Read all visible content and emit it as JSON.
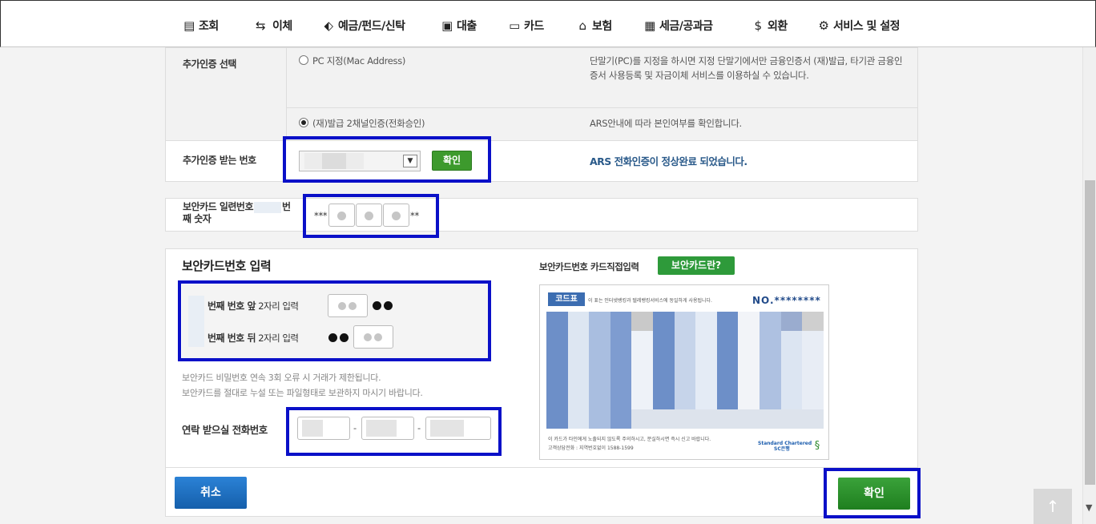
{
  "nav": [
    {
      "label": "조회",
      "icon": "list-icon",
      "glyph": "▤"
    },
    {
      "label": "이체",
      "icon": "transfer-icon",
      "glyph": "⇆"
    },
    {
      "label": "예금/펀드/신탁",
      "icon": "deposit-icon",
      "glyph": "⬖"
    },
    {
      "label": "대출",
      "icon": "loan-icon",
      "glyph": "▣"
    },
    {
      "label": "카드",
      "icon": "card-icon",
      "glyph": "▭"
    },
    {
      "label": "보험",
      "icon": "house-icon",
      "glyph": "⌂"
    },
    {
      "label": "세금/공과금",
      "icon": "tax-icon",
      "glyph": "▦"
    },
    {
      "label": "외환",
      "icon": "dollar-icon",
      "glyph": "$"
    },
    {
      "label": "서비스 및 설정",
      "icon": "gear-icon",
      "glyph": "⚙"
    }
  ],
  "auth": {
    "select_label": "추가인증 선택",
    "option_pc": "PC 지정(Mac Address)",
    "option_pc_desc": "단말기(PC)를 지정을 하시면 지정 단말기에서만 금융인증서 (재)발급, 타기관 금융인증서 사용등록 및 자금이체 서비스를 이용하실 수 있습니다.",
    "option_phone": "(재)발급 2채널인증(전화승인)",
    "option_phone_desc": "ARS안내에 따라 본인여부를 확인합니다.",
    "number_label": "추가인증 받는 번호",
    "confirm_small": "확인",
    "ars_message": "ARS 전화인증이 정상완료 되었습니다."
  },
  "serial": {
    "label_line1": "보안카드 일련번호",
    "label_line1_end": "번",
    "label_line2": "째 숫자",
    "prefix": "***",
    "suffix": "**"
  },
  "card_input": {
    "title": "보안카드번호 입력",
    "row1_label_bold": "번째 번호 앞",
    "row1_label_rest": " 2자리 입력",
    "row2_label_bold": "번째 번호 뒤",
    "row2_label_rest": " 2자리 입력",
    "warning1": "보안카드 비밀번호 연속 3회 오류 시 거래가 제한됩니다.",
    "warning2": "보안카드를 절대로 누설 또는 파일형태로 보관하지 마시기 바랍니다.",
    "phone_label": "연락 받으실 전화번호",
    "dash": "-"
  },
  "card_side": {
    "direct_input": "보안카드번호 카드직접입력",
    "what_button": "보안카드란?",
    "card_tag": "코드표",
    "card_top_text": "이 표는 인터넷뱅킹과 텔레뱅킹서비스에 동일하게 사용됩니다.",
    "card_no": "NO.********",
    "card_bottom1": "이 카드가 타인에게 노출되지 않도록 주의하시고, 분실하시면 즉시 신고 바랍니다.",
    "card_bottom2": "고객상담전화 : 지역번호없이 1588-1599",
    "brand1": "Standard Chartered",
    "brand2": "SC은행"
  },
  "buttons": {
    "cancel": "취소",
    "confirm": "확인"
  },
  "colors": {
    "highlight": "#0a10c8",
    "green": "#2e9a3a",
    "blue": "#1b6fc4"
  }
}
